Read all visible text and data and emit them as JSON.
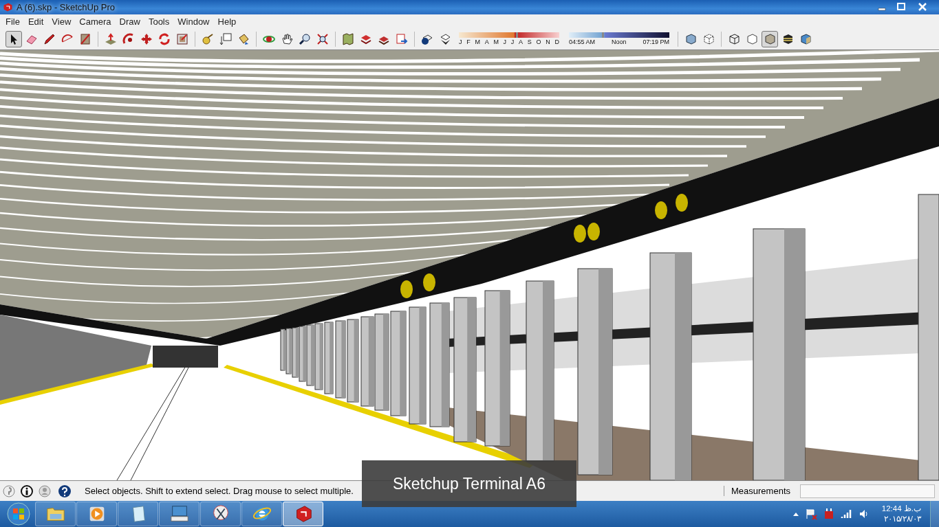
{
  "window": {
    "title": "A (6).skp - SketchUp Pro"
  },
  "menu": [
    "File",
    "Edit",
    "View",
    "Camera",
    "Draw",
    "Tools",
    "Window",
    "Help"
  ],
  "toolbar": {
    "tools": [
      {
        "kind": "select",
        "selected": true
      },
      {
        "kind": "eraser",
        "selected": false
      },
      {
        "kind": "pencil",
        "selected": false
      },
      {
        "kind": "arc",
        "selected": false
      },
      {
        "kind": "rectangle",
        "selected": false
      },
      {
        "kind": "pushpull",
        "selected": false
      },
      {
        "kind": "followme",
        "selected": false
      },
      {
        "kind": "move",
        "selected": false
      },
      {
        "kind": "rotate",
        "selected": false
      },
      {
        "kind": "offset",
        "selected": false
      },
      {
        "kind": "tape",
        "selected": false
      },
      {
        "kind": "text",
        "selected": false
      },
      {
        "kind": "paint",
        "selected": false
      },
      {
        "kind": "orbit",
        "selected": false
      },
      {
        "kind": "pan",
        "selected": false
      },
      {
        "kind": "zoom",
        "selected": false
      },
      {
        "kind": "extents",
        "selected": false
      },
      {
        "kind": "map",
        "selected": false
      },
      {
        "kind": "warehouse",
        "selected": false
      },
      {
        "kind": "components",
        "selected": false
      },
      {
        "kind": "share",
        "selected": false
      },
      {
        "kind": "shadowinfo",
        "selected": false
      },
      {
        "kind": "shadowtoggle",
        "selected": false
      }
    ],
    "months": [
      "J",
      "F",
      "M",
      "A",
      "M",
      "J",
      "J",
      "A",
      "S",
      "O",
      "N",
      "D"
    ],
    "month_slider": {
      "level": 0.57
    },
    "time_slider": {
      "level": 0.33
    },
    "times": [
      "04:55 AM",
      "Noon",
      "07:19 PM"
    ],
    "styles": [
      {
        "kind": "xray",
        "selected": false
      },
      {
        "kind": "backedges",
        "selected": false
      },
      {
        "kind": "wireframe",
        "selected": false
      },
      {
        "kind": "hiddenline",
        "selected": false
      },
      {
        "kind": "shaded",
        "selected": true
      },
      {
        "kind": "textured",
        "selected": false
      },
      {
        "kind": "monochrome",
        "selected": false
      }
    ]
  },
  "caption": "Sketchup Terminal A6",
  "status_bar": {
    "message": "Select objects. Shift to extend select. Drag mouse to select multiple.",
    "measurements_label": "Measurements"
  },
  "taskbar": {
    "apps": [
      {
        "kind": "explorer",
        "selected": false
      },
      {
        "kind": "media",
        "selected": false
      },
      {
        "kind": "notepad",
        "selected": false
      },
      {
        "kind": "keyboard",
        "selected": false
      },
      {
        "kind": "snipping",
        "selected": false
      },
      {
        "kind": "browser",
        "selected": false
      },
      {
        "kind": "sketchup",
        "selected": true
      }
    ],
    "time": "12:44 ب.ظ",
    "date": "۲۰۱۵/۲۸/۰۳"
  }
}
